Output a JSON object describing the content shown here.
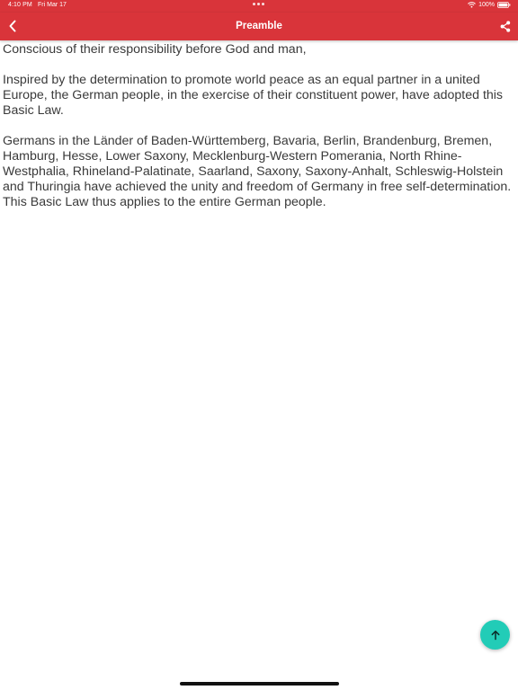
{
  "status_bar": {
    "time": "4:10 PM",
    "date": "Fri Mar 17",
    "battery": "100%"
  },
  "nav": {
    "title": "Preamble",
    "back_icon": "chevron-left-icon",
    "share_icon": "share-icon"
  },
  "content": {
    "paragraphs": [
      "Conscious of their responsibility before God and man,",
      "Inspired by the determination to promote world peace as an equal partner in a united Europe, the German people, in the exercise of their constituent power, have adopted this Basic Law.",
      "Germans in the Länder of Baden-Württemberg, Bavaria, Berlin, Brandenburg, Bremen, Hamburg, Hesse, Lower Saxony, Mecklenburg-Western Pomerania, North Rhine-Westphalia, Rhineland-Palatinate, Saarland, Saxony, Saxony-Anhalt, Schleswig-Holstein and Thuringia have achieved the unity and freedom of Germany in free self-determination. This Basic Law thus applies to the entire German people."
    ]
  },
  "fab": {
    "icon": "arrow-up-icon"
  },
  "colors": {
    "header": "#d9343a",
    "fab": "#22ccb7",
    "text": "#3a3a3a"
  }
}
